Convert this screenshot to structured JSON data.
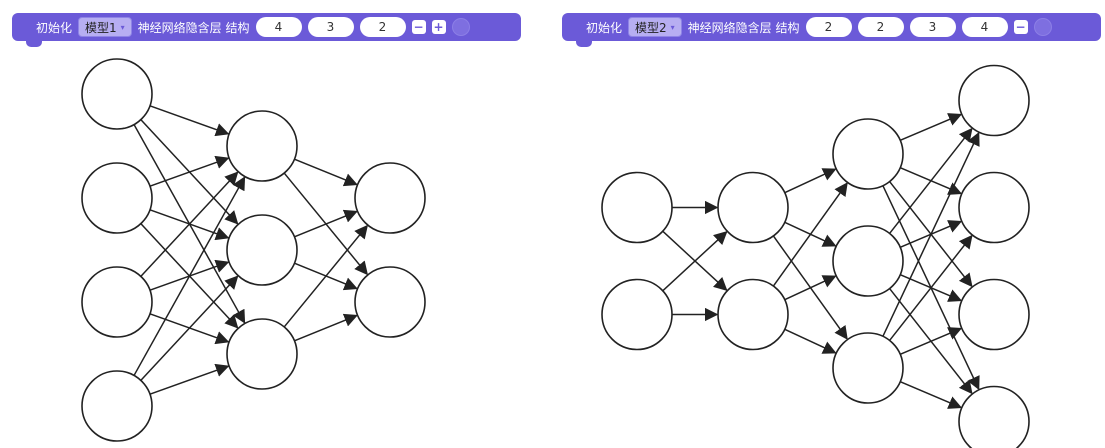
{
  "blocks": [
    {
      "init_label": "初始化",
      "model": "模型1",
      "structure_label": "神经网络隐含层 结构",
      "layers": [
        "4",
        "3",
        "2"
      ],
      "buttons": [
        "minus",
        "plus"
      ]
    },
    {
      "init_label": "初始化",
      "model": "模型2",
      "structure_label": "神经网络隐含层 结构",
      "layers": [
        "2",
        "2",
        "3",
        "4"
      ],
      "buttons": [
        "minus"
      ]
    }
  ],
  "diagrams": [
    {
      "layer_sizes": [
        4,
        3,
        2
      ]
    },
    {
      "layer_sizes": [
        2,
        2,
        3,
        4
      ]
    }
  ],
  "colors": {
    "block": "#6b5ad8",
    "dropdown": "#b7aef2",
    "stroke": "#222222"
  },
  "icons": [
    "minus-icon",
    "plus-icon",
    "gear-icon",
    "dropdown-arrow-icon"
  ]
}
